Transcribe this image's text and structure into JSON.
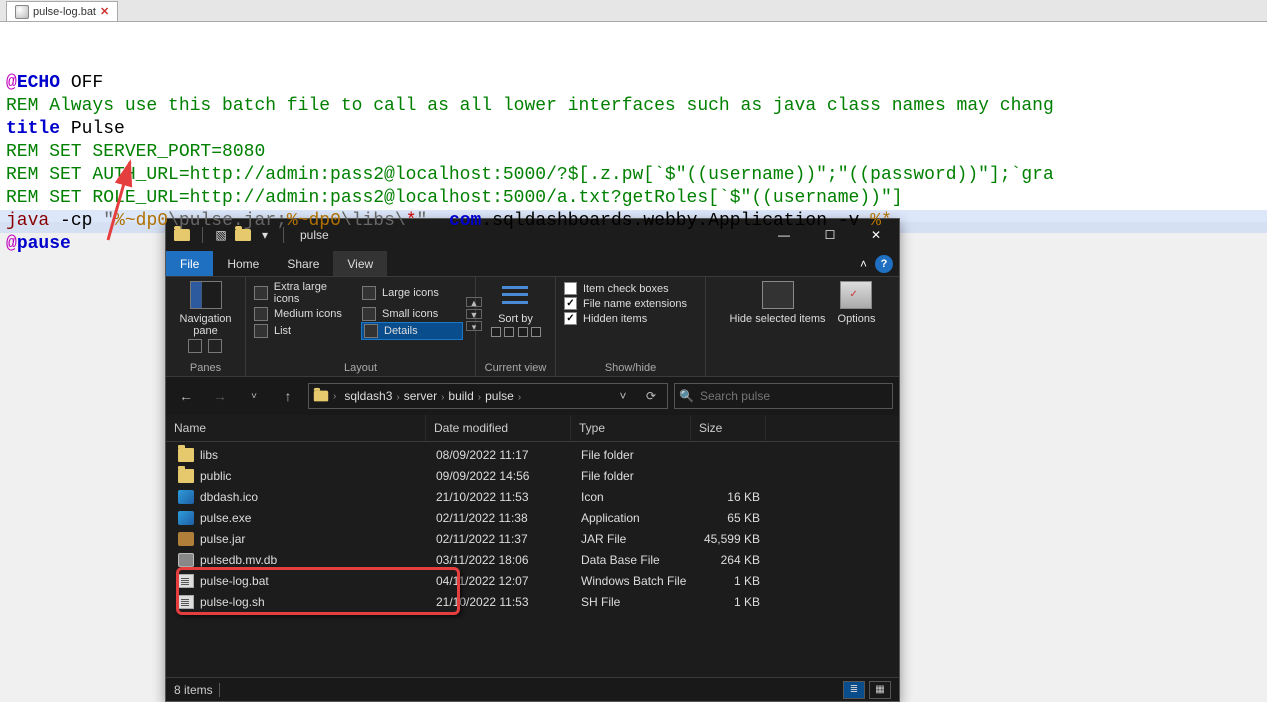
{
  "editor": {
    "tab_name": "pulse-log.bat",
    "lines": [
      {
        "segments": [
          {
            "t": "@",
            "cls": "c-at"
          },
          {
            "t": "ECHO",
            "cls": "c-kw"
          },
          {
            "t": " OFF",
            "cls": ""
          }
        ]
      },
      {
        "segments": [
          {
            "t": "REM Always use this batch file to call as all lower interfaces such as java class names may chang",
            "cls": "c-rem"
          }
        ]
      },
      {
        "segments": [
          {
            "t": "title",
            "cls": "c-kw"
          },
          {
            "t": " Pulse",
            "cls": ""
          }
        ]
      },
      {
        "segments": [
          {
            "t": "REM SET SERVER_PORT=8080",
            "cls": "c-rem"
          }
        ]
      },
      {
        "segments": [
          {
            "t": "REM SET AUTH_URL=http://admin:pass2@localhost:5000/?$[.z.pw[`$\"((username))\";\"((password))\"];`gra",
            "cls": "c-rem"
          }
        ]
      },
      {
        "segments": [
          {
            "t": "REM SET ROLE_URL=http://admin:pass2@localhost:5000/a.txt?getRoles[`$\"((username))\"]",
            "cls": "c-rem"
          }
        ]
      },
      {
        "segments": [
          {
            "t": "java",
            "cls": "c-java"
          },
          {
            "t": " -cp ",
            "cls": ""
          },
          {
            "t": "\"",
            "cls": "c-str"
          },
          {
            "t": "%~dp0",
            "cls": "c-var"
          },
          {
            "t": "\\pulse.jar;",
            "cls": "c-str"
          },
          {
            "t": "%~dp0",
            "cls": "c-var"
          },
          {
            "t": "\\libs\\",
            "cls": "c-str"
          },
          {
            "t": "*",
            "cls": "c-red"
          },
          {
            "t": "\"",
            "cls": "c-str"
          },
          {
            "t": "  com",
            "cls": "c-kw"
          },
          {
            "t": ".sqldashboards.webby.Application -v ",
            "cls": ""
          },
          {
            "t": "%*",
            "cls": "c-var"
          }
        ]
      },
      {
        "segments": [
          {
            "t": "@",
            "cls": "c-at"
          },
          {
            "t": "pause",
            "cls": "c-kw"
          }
        ]
      }
    ]
  },
  "explorer": {
    "title": "pulse",
    "menu": {
      "file": "File",
      "home": "Home",
      "share": "Share",
      "view": "View"
    },
    "ribbon": {
      "panes_label": "Panes",
      "nav_pane": "Navigation pane",
      "layout_label": "Layout",
      "layout_items": [
        "Extra large icons",
        "Large icons",
        "Medium icons",
        "Small icons",
        "List",
        "Details"
      ],
      "current_view_label": "Current view",
      "sort_by": "Sort by",
      "showhide_label": "Show/hide",
      "item_checks": "Item check boxes",
      "filename_ext": "File name extensions",
      "hidden_items": "Hidden items",
      "hide_selected": "Hide selected items",
      "options": "Options"
    },
    "breadcrumb": [
      "sqldash3",
      "server",
      "build",
      "pulse"
    ],
    "search_placeholder": "Search pulse",
    "columns": {
      "name": "Name",
      "date": "Date modified",
      "type": "Type",
      "size": "Size"
    },
    "files": [
      {
        "icon": "folder",
        "name": "libs",
        "date": "08/09/2022 11:17",
        "type": "File folder",
        "size": ""
      },
      {
        "icon": "folder",
        "name": "public",
        "date": "09/09/2022 14:56",
        "type": "File folder",
        "size": ""
      },
      {
        "icon": "ico",
        "name": "dbdash.ico",
        "date": "21/10/2022 11:53",
        "type": "Icon",
        "size": "16 KB"
      },
      {
        "icon": "exe",
        "name": "pulse.exe",
        "date": "02/11/2022 11:38",
        "type": "Application",
        "size": "65 KB"
      },
      {
        "icon": "jar",
        "name": "pulse.jar",
        "date": "02/11/2022 11:37",
        "type": "JAR File",
        "size": "45,599 KB"
      },
      {
        "icon": "db",
        "name": "pulsedb.mv.db",
        "date": "03/11/2022 18:06",
        "type": "Data Base File",
        "size": "264 KB"
      },
      {
        "icon": "bat",
        "name": "pulse-log.bat",
        "date": "04/11/2022 12:07",
        "type": "Windows Batch File",
        "size": "1 KB"
      },
      {
        "icon": "sh",
        "name": "pulse-log.sh",
        "date": "21/10/2022 11:53",
        "type": "SH File",
        "size": "1 KB"
      }
    ],
    "status": "8 items"
  }
}
